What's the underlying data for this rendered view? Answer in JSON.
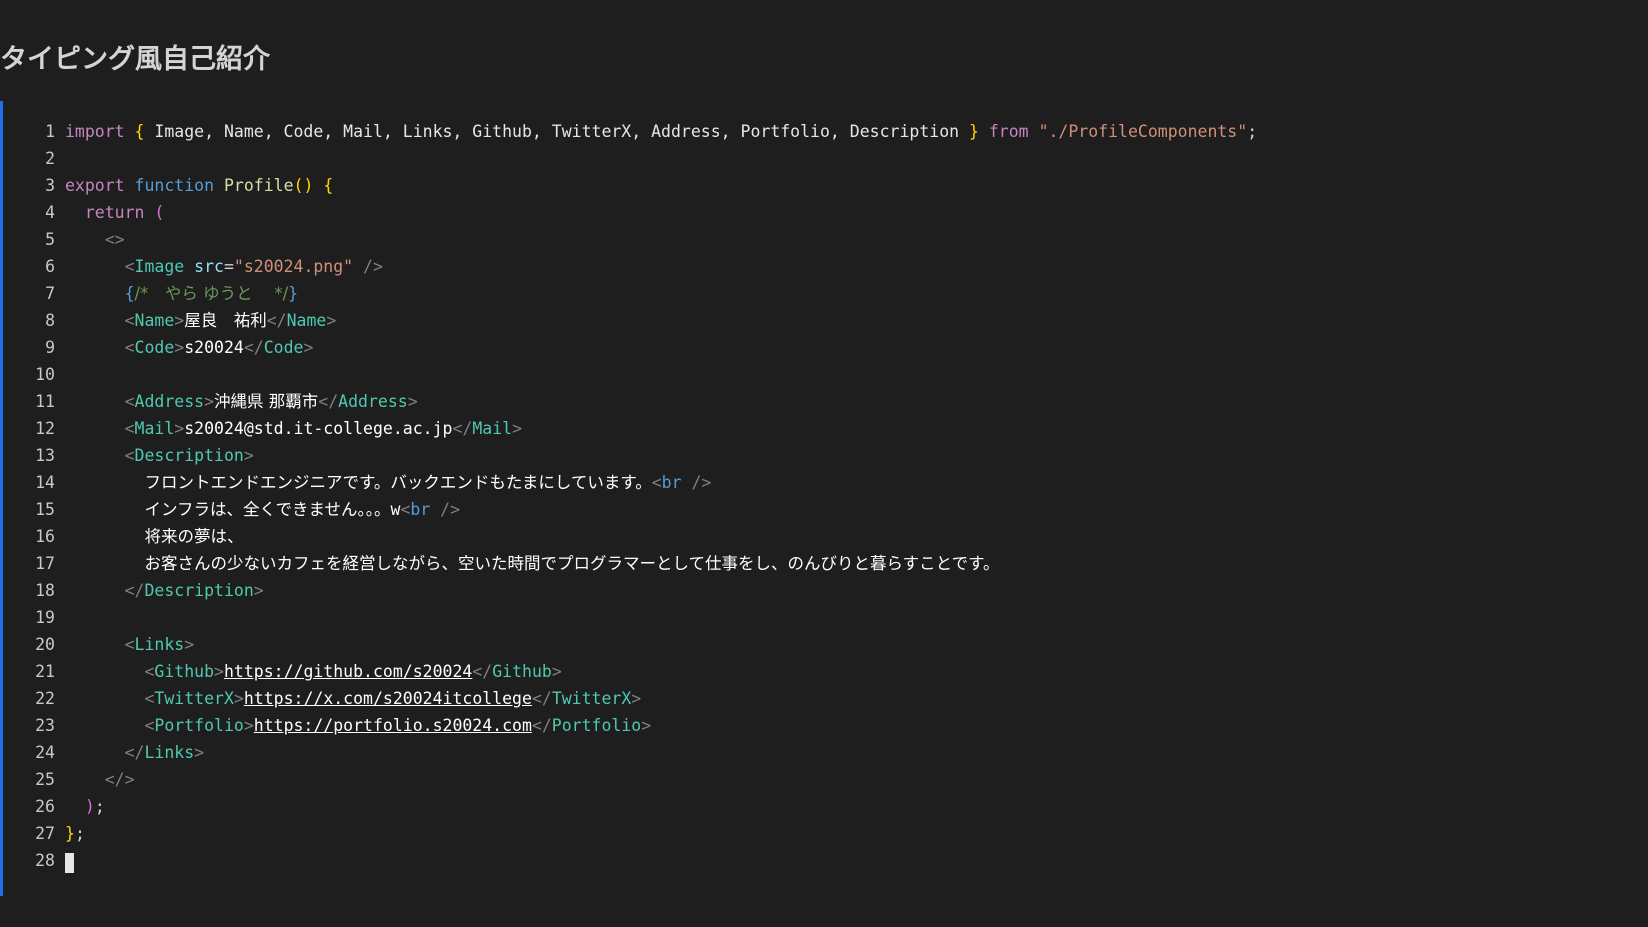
{
  "page": {
    "title": "タイピング風自己紹介"
  },
  "colors": {
    "background": "#1e1e1e",
    "accent_border": "#1f6feb",
    "keyword": "#c586c0",
    "storage": "#569cd6",
    "function": "#dcdcaa",
    "bracket": "#ffd700",
    "string": "#ce9178",
    "tag": "#4ec9b0",
    "attribute": "#9cdcfe",
    "comment": "#6a9955"
  },
  "editor": {
    "cursor_line": 28,
    "lines": [
      {
        "n": "1",
        "tokens": [
          {
            "t": "import",
            "c": "kw"
          },
          {
            "t": " ",
            "c": "plain"
          },
          {
            "t": "{",
            "c": "br"
          },
          {
            "t": " Image, Name, Code, Mail, Links, Github, TwitterX, Address, Portfolio, Description ",
            "c": "var"
          },
          {
            "t": "}",
            "c": "br"
          },
          {
            "t": " ",
            "c": "plain"
          },
          {
            "t": "from",
            "c": "kw"
          },
          {
            "t": " ",
            "c": "plain"
          },
          {
            "t": "\"./ProfileComponents\"",
            "c": "str"
          },
          {
            "t": ";",
            "c": "plain"
          }
        ]
      },
      {
        "n": "2",
        "tokens": []
      },
      {
        "n": "3",
        "tokens": [
          {
            "t": "export",
            "c": "kw"
          },
          {
            "t": " ",
            "c": "plain"
          },
          {
            "t": "function",
            "c": "kw2"
          },
          {
            "t": " ",
            "c": "plain"
          },
          {
            "t": "Profile",
            "c": "fn"
          },
          {
            "t": "()",
            "c": "br"
          },
          {
            "t": " ",
            "c": "plain"
          },
          {
            "t": "{",
            "c": "br"
          }
        ]
      },
      {
        "n": "4",
        "tokens": [
          {
            "t": "  ",
            "c": "plain"
          },
          {
            "t": "return",
            "c": "kw"
          },
          {
            "t": " ",
            "c": "plain"
          },
          {
            "t": "(",
            "c": "br2"
          }
        ]
      },
      {
        "n": "5",
        "tokens": [
          {
            "t": "    ",
            "c": "plain"
          },
          {
            "t": "<>",
            "c": "punc"
          }
        ]
      },
      {
        "n": "6",
        "tokens": [
          {
            "t": "      ",
            "c": "plain"
          },
          {
            "t": "<",
            "c": "punc"
          },
          {
            "t": "Image",
            "c": "tag"
          },
          {
            "t": " ",
            "c": "plain"
          },
          {
            "t": "src",
            "c": "attr"
          },
          {
            "t": "=",
            "c": "plain"
          },
          {
            "t": "\"s20024.png\"",
            "c": "str"
          },
          {
            "t": " />",
            "c": "punc"
          }
        ]
      },
      {
        "n": "7",
        "tokens": [
          {
            "t": "      ",
            "c": "plain"
          },
          {
            "t": "{",
            "c": "cbr"
          },
          {
            "t": "/*　やら ゆうと　 */",
            "c": "com",
            "jp": true
          },
          {
            "t": "}",
            "c": "cbr"
          }
        ]
      },
      {
        "n": "8",
        "tokens": [
          {
            "t": "      ",
            "c": "plain"
          },
          {
            "t": "<",
            "c": "punc"
          },
          {
            "t": "Name",
            "c": "tag"
          },
          {
            "t": ">",
            "c": "punc"
          },
          {
            "t": "屋良　祐利",
            "c": "text",
            "jp": true
          },
          {
            "t": "</",
            "c": "punc"
          },
          {
            "t": "Name",
            "c": "tag"
          },
          {
            "t": ">",
            "c": "punc"
          }
        ]
      },
      {
        "n": "9",
        "tokens": [
          {
            "t": "      ",
            "c": "plain"
          },
          {
            "t": "<",
            "c": "punc"
          },
          {
            "t": "Code",
            "c": "tag"
          },
          {
            "t": ">",
            "c": "punc"
          },
          {
            "t": "s20024",
            "c": "text"
          },
          {
            "t": "</",
            "c": "punc"
          },
          {
            "t": "Code",
            "c": "tag"
          },
          {
            "t": ">",
            "c": "punc"
          }
        ]
      },
      {
        "n": "10",
        "tokens": []
      },
      {
        "n": "11",
        "tokens": [
          {
            "t": "      ",
            "c": "plain"
          },
          {
            "t": "<",
            "c": "punc"
          },
          {
            "t": "Address",
            "c": "tag"
          },
          {
            "t": ">",
            "c": "punc"
          },
          {
            "t": "沖縄県 那覇市",
            "c": "text",
            "jp": true
          },
          {
            "t": "</",
            "c": "punc"
          },
          {
            "t": "Address",
            "c": "tag"
          },
          {
            "t": ">",
            "c": "punc"
          }
        ]
      },
      {
        "n": "12",
        "tokens": [
          {
            "t": "      ",
            "c": "plain"
          },
          {
            "t": "<",
            "c": "punc"
          },
          {
            "t": "Mail",
            "c": "tag"
          },
          {
            "t": ">",
            "c": "punc"
          },
          {
            "t": "s20024@std.it-college.ac.jp",
            "c": "text"
          },
          {
            "t": "</",
            "c": "punc"
          },
          {
            "t": "Mail",
            "c": "tag"
          },
          {
            "t": ">",
            "c": "punc"
          }
        ]
      },
      {
        "n": "13",
        "tokens": [
          {
            "t": "      ",
            "c": "plain"
          },
          {
            "t": "<",
            "c": "punc"
          },
          {
            "t": "Description",
            "c": "tag"
          },
          {
            "t": ">",
            "c": "punc"
          }
        ]
      },
      {
        "n": "14",
        "tokens": [
          {
            "t": "        ",
            "c": "plain"
          },
          {
            "t": "フロントエンドエンジニアです。バックエンドもたまにしています。",
            "c": "text",
            "jp": true
          },
          {
            "t": "<",
            "c": "punc"
          },
          {
            "t": "br",
            "c": "kw2"
          },
          {
            "t": " />",
            "c": "punc"
          }
        ]
      },
      {
        "n": "15",
        "tokens": [
          {
            "t": "        ",
            "c": "plain"
          },
          {
            "t": "インフラは、全くできません。。。",
            "c": "text",
            "jp": true
          },
          {
            "t": "w",
            "c": "text"
          },
          {
            "t": "<",
            "c": "punc"
          },
          {
            "t": "br",
            "c": "kw2"
          },
          {
            "t": " />",
            "c": "punc"
          }
        ]
      },
      {
        "n": "16",
        "tokens": [
          {
            "t": "        ",
            "c": "plain"
          },
          {
            "t": "将来の夢は、",
            "c": "text",
            "jp": true
          }
        ]
      },
      {
        "n": "17",
        "tokens": [
          {
            "t": "        ",
            "c": "plain"
          },
          {
            "t": "お客さんの少ないカフェを経営しながら、空いた時間でプログラマーとして仕事をし、のんびりと暮らすことです。",
            "c": "text",
            "jp": true
          }
        ]
      },
      {
        "n": "18",
        "tokens": [
          {
            "t": "      ",
            "c": "plain"
          },
          {
            "t": "</",
            "c": "punc"
          },
          {
            "t": "Description",
            "c": "tag"
          },
          {
            "t": ">",
            "c": "punc"
          }
        ]
      },
      {
        "n": "19",
        "tokens": []
      },
      {
        "n": "20",
        "tokens": [
          {
            "t": "      ",
            "c": "plain"
          },
          {
            "t": "<",
            "c": "punc"
          },
          {
            "t": "Links",
            "c": "tag"
          },
          {
            "t": ">",
            "c": "punc"
          }
        ]
      },
      {
        "n": "21",
        "tokens": [
          {
            "t": "        ",
            "c": "plain"
          },
          {
            "t": "<",
            "c": "punc"
          },
          {
            "t": "Github",
            "c": "tag"
          },
          {
            "t": ">",
            "c": "punc"
          },
          {
            "t": "https://github.com/s20024",
            "c": "link"
          },
          {
            "t": "</",
            "c": "punc"
          },
          {
            "t": "Github",
            "c": "tag"
          },
          {
            "t": ">",
            "c": "punc"
          }
        ]
      },
      {
        "n": "22",
        "tokens": [
          {
            "t": "        ",
            "c": "plain"
          },
          {
            "t": "<",
            "c": "punc"
          },
          {
            "t": "TwitterX",
            "c": "tag"
          },
          {
            "t": ">",
            "c": "punc"
          },
          {
            "t": "https://x.com/s20024itcollege",
            "c": "link"
          },
          {
            "t": "</",
            "c": "punc"
          },
          {
            "t": "TwitterX",
            "c": "tag"
          },
          {
            "t": ">",
            "c": "punc"
          }
        ]
      },
      {
        "n": "23",
        "tokens": [
          {
            "t": "        ",
            "c": "plain"
          },
          {
            "t": "<",
            "c": "punc"
          },
          {
            "t": "Portfolio",
            "c": "tag"
          },
          {
            "t": ">",
            "c": "punc"
          },
          {
            "t": "https://portfolio.s20024.com",
            "c": "link"
          },
          {
            "t": "</",
            "c": "punc"
          },
          {
            "t": "Portfolio",
            "c": "tag"
          },
          {
            "t": ">",
            "c": "punc"
          }
        ]
      },
      {
        "n": "24",
        "tokens": [
          {
            "t": "      ",
            "c": "plain"
          },
          {
            "t": "</",
            "c": "punc"
          },
          {
            "t": "Links",
            "c": "tag"
          },
          {
            "t": ">",
            "c": "punc"
          }
        ]
      },
      {
        "n": "25",
        "tokens": [
          {
            "t": "    ",
            "c": "plain"
          },
          {
            "t": "</>",
            "c": "punc"
          }
        ]
      },
      {
        "n": "26",
        "tokens": [
          {
            "t": "  ",
            "c": "plain"
          },
          {
            "t": ")",
            "c": "br2"
          },
          {
            "t": ";",
            "c": "plain"
          }
        ]
      },
      {
        "n": "27",
        "tokens": [
          {
            "t": "}",
            "c": "br"
          },
          {
            "t": ";",
            "c": "plain"
          }
        ]
      },
      {
        "n": "28",
        "tokens": []
      }
    ]
  }
}
